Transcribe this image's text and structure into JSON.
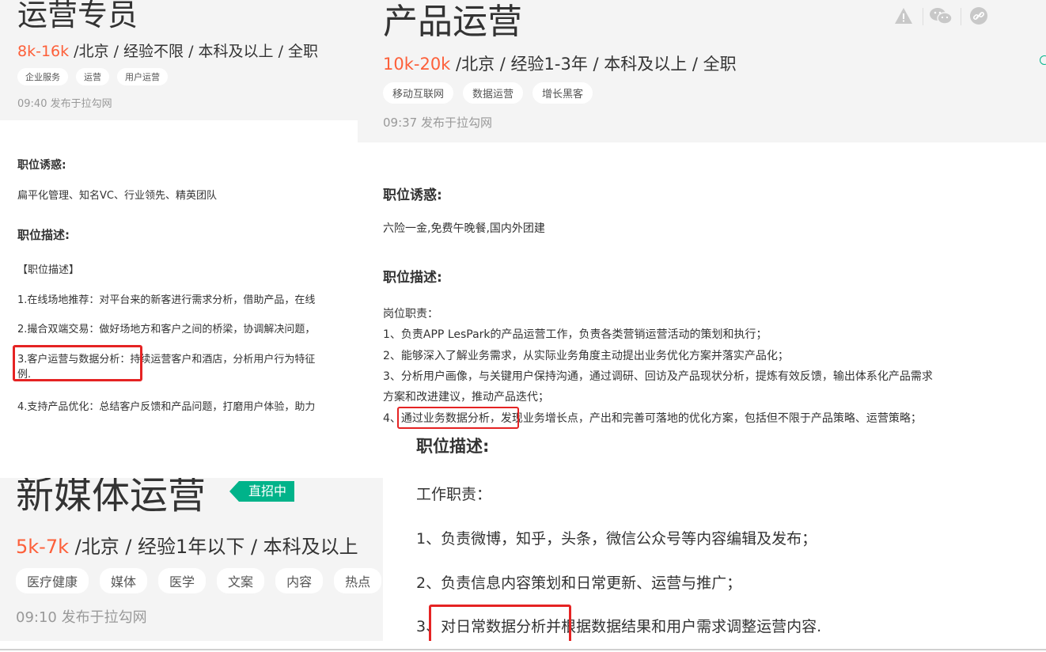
{
  "left_card": {
    "title": "运营专员",
    "salary": "8k-16k",
    "meta": " /北京 / 经验不限 / 本科及以上 / 全职",
    "tags": [
      "企业服务",
      "运营",
      "用户运营"
    ],
    "publish": "09:40  发布于拉勾网",
    "perks_heading": "职位诱惑:",
    "perks_text": "扁平化管理、知名VC、行业领先、精英团队",
    "desc_heading": "职位描述:",
    "desc_lines": [
      "【职位描述】",
      "1.在线场地推荐：对平台来的新客进行需求分析，借助产品，在线",
      "2.撮合双端交易：做好场地方和客户之间的桥梁，协调解决问题，",
      "3.客户运营与数据分析：持续运营客户和酒店，分析用户行为特征",
      "例.",
      "4.支持产品优化：总结客户反馈和产品问题，打磨用户体验，助力"
    ]
  },
  "right_card": {
    "title": "产品运营",
    "salary": "10k-20k",
    "meta": " /北京 / 经验1-3年 / 本科及以上 / 全职",
    "tags": [
      "移动互联网",
      "数据运营",
      "增长黑客"
    ],
    "publish": "09:37  发布于拉勾网",
    "perks_heading": "职位诱惑:",
    "perks_text": "六险一金,免费午晚餐,国内外团建",
    "desc_heading": "职位描述:",
    "desc_lines": [
      "岗位职责：",
      "1、负责APP LesPark的产品运营工作，负责各类营销运营活动的策划和执行；",
      "2、能够深入了解业务需求，从实际业务角度主动提出业务优化方案并落实产品化；",
      "3、分析用户画像，与关键用户保持沟通，通过调研、回访及产品现状分析，提炼有效反馈，输出体系化产品需求",
      "方案和改进建议，推动产品迭代；",
      "4、通过业务数据分析，发现业务增长点，产出和完善可落地的优化方案，包括但不限于产品策略、运营策略；"
    ]
  },
  "bottom_left_card": {
    "title": "新媒体运营",
    "badge": "直招中",
    "salary": "5k-7k",
    "meta": " /北京 / 经验1年以下 / 本科及以上",
    "tags": [
      "医疗健康",
      "媒体",
      "医学",
      "文案",
      "内容",
      "热点"
    ],
    "publish": "09:10  发布于拉勾网"
  },
  "bottom_right_card": {
    "desc_heading": "职位描述:",
    "lines": [
      "工作职责：",
      "1、负责微博，知乎，头条，微信公众号等内容编辑及发布；",
      "2、负责信息内容策划和日常更新、运营与推广；",
      "3、对日常数据分析并根据数据结果和用户需求调整运营内容."
    ]
  },
  "icons": [
    "warning-icon",
    "wechat-icon",
    "link-icon"
  ],
  "colors": {
    "salary": "#fd5f39",
    "badge": "#00b38a",
    "highlight": "#e52323"
  }
}
